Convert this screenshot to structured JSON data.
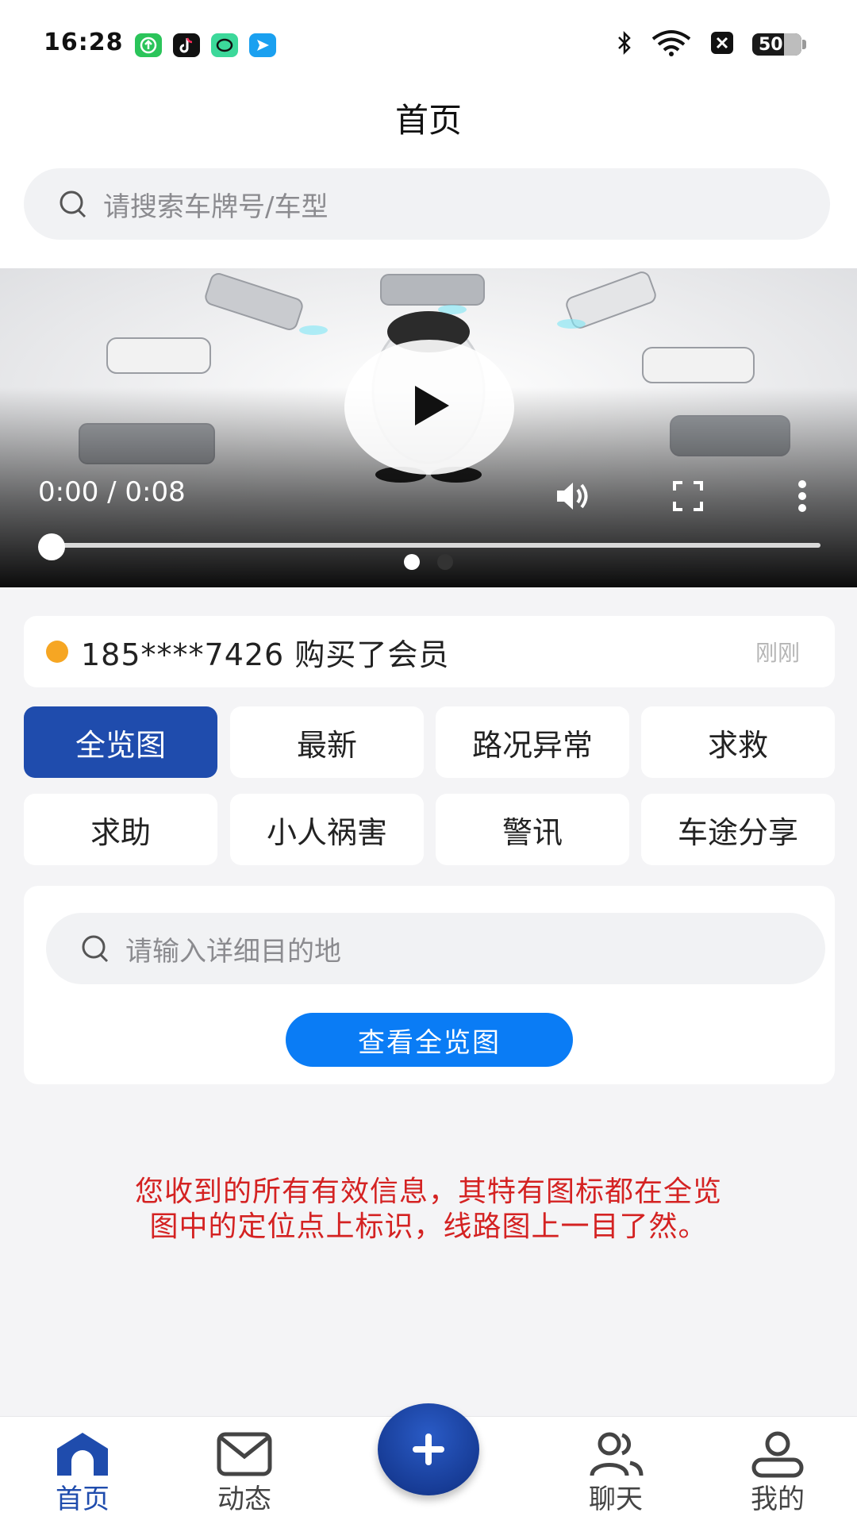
{
  "status_bar": {
    "time": "16:28",
    "battery": "50",
    "app_icons": [
      "upload-app-icon",
      "tiktok-icon",
      "chat-app-icon",
      "plane-app-icon"
    ],
    "system_icons": [
      "bluetooth-icon",
      "wifi-icon",
      "sim-off-icon"
    ]
  },
  "header": {
    "title": "首页"
  },
  "search": {
    "placeholder": "请搜索车牌号/车型"
  },
  "video": {
    "time": "0:00 / 0:08",
    "progress": 0.0,
    "slide_count": 2,
    "active_slide": 0
  },
  "notice": {
    "message": "185****7426 购买了会员",
    "time": "刚刚"
  },
  "categories": [
    {
      "label": "全览图",
      "active": true
    },
    {
      "label": "最新",
      "active": false
    },
    {
      "label": "路况异常",
      "active": false
    },
    {
      "label": "求救",
      "active": false
    },
    {
      "label": "求助",
      "active": false
    },
    {
      "label": "小人祸害",
      "active": false
    },
    {
      "label": "警讯",
      "active": false
    },
    {
      "label": "车途分享",
      "active": false
    }
  ],
  "destination": {
    "placeholder": "请输入详细目的地",
    "button": "查看全览图"
  },
  "info": {
    "line1": "您收到的所有有效信息，其特有图标都在全览",
    "line2": "图中的定位点上标识，线路图上一目了然。"
  },
  "tabbar": {
    "items": [
      {
        "label": "首页",
        "icon": "home-icon",
        "active": true
      },
      {
        "label": "动态",
        "icon": "mail-icon",
        "active": false
      },
      {
        "label": "聊天",
        "icon": "users-icon",
        "active": false
      },
      {
        "label": "我的",
        "icon": "user-icon",
        "active": false
      }
    ],
    "fab_icon": "plus-icon"
  },
  "colors": {
    "primary": "#1f4cad",
    "button_blue": "#0a7cf5",
    "notice_dot": "#f6a623",
    "info_red": "#d42222"
  }
}
